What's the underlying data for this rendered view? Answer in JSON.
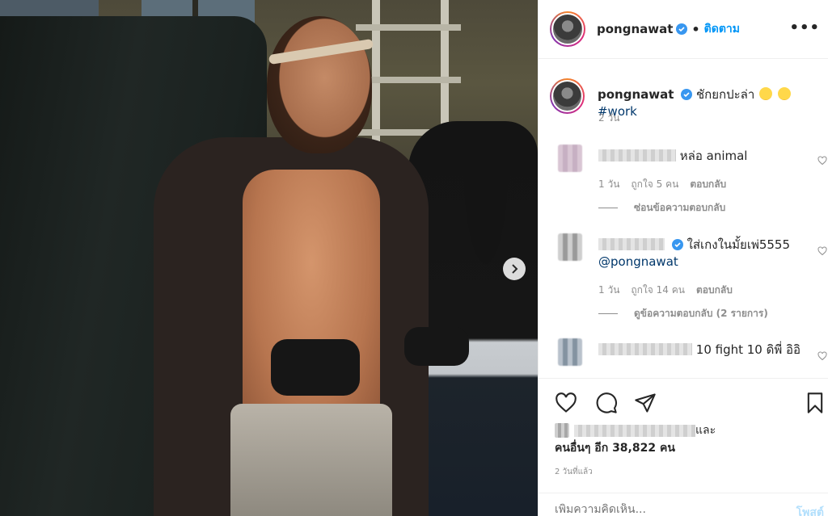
{
  "post": {
    "username": "pongnawat",
    "follow_label": "ติดตาม",
    "more_label": "•••"
  },
  "caption": {
    "username": "pongnawat",
    "text": "ชักยกปะล่า",
    "hashtag": "#work",
    "time": "2 วัน"
  },
  "comments": [
    {
      "text": "หล่อ animal",
      "time": "1 วัน",
      "likes": "ถูกใจ 5 คน",
      "reply_label": "ตอบกลับ",
      "replies_label": "ซ่อนข้อความตอบกลับ"
    },
    {
      "text": "ใส่เกงในมั้ยเพ่5555",
      "mention": "@pongnawat",
      "time": "1 วัน",
      "likes": "ถูกใจ 14 คน",
      "reply_label": "ตอบกลับ",
      "replies_label": "ดูข้อความตอบกลับ (2 รายการ)"
    },
    {
      "text": "10 fight 10 ดิพี่ อิอิ"
    }
  ],
  "likes": {
    "and_label": "และ",
    "others": "คนอื่นๆ อีก 38,822 คน"
  },
  "post_time": "2 วันที่แล้ว",
  "add_comment": {
    "placeholder": "เพิ่มความคิดเห็น...",
    "post_label": "โพสต์"
  },
  "colors": {
    "link": "#0095f6",
    "hashtag": "#00376b",
    "muted": "#8e8e8e",
    "post_disabled": "#b2dffc"
  }
}
